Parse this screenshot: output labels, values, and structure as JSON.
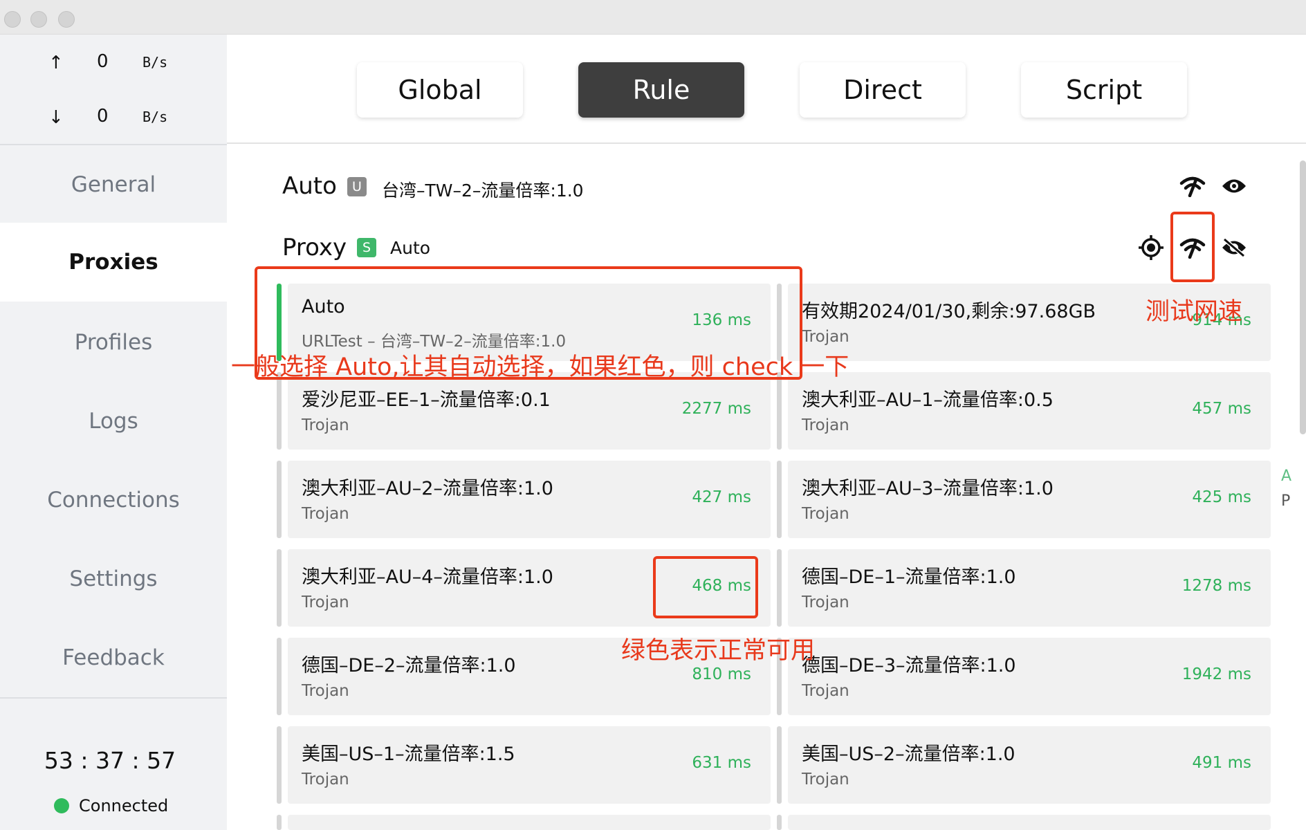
{
  "traffic": {
    "up": {
      "arrow": "↑",
      "value": "0",
      "unit": "B/s"
    },
    "down": {
      "arrow": "↓",
      "value": "0",
      "unit": "B/s"
    }
  },
  "nav": {
    "general": "General",
    "proxies": "Proxies",
    "profiles": "Profiles",
    "logs": "Logs",
    "connections": "Connections",
    "settings": "Settings",
    "feedback": "Feedback",
    "active": "Proxies"
  },
  "status": {
    "uptime": "53 : 37 : 57",
    "connection": "Connected"
  },
  "modes": {
    "global": "Global",
    "rule": "Rule",
    "direct": "Direct",
    "script": "Script",
    "active": "Rule"
  },
  "groups": {
    "auto": {
      "name": "Auto",
      "badge": "U",
      "current": "台湾–TW–2–流量倍率:1.0"
    },
    "proxy": {
      "name": "Proxy",
      "badge": "S",
      "current": "Auto"
    }
  },
  "proxies": [
    {
      "name": "Auto",
      "type": "URLTest – 台湾–TW–2–流量倍率:1.0",
      "delay": "136 ms",
      "selected": true
    },
    {
      "name": "有效期2024/01/30,剩余:97.68GB",
      "type": "Trojan",
      "delay": "914 ms"
    },
    {
      "name": "爱沙尼亚–EE–1–流量倍率:0.1",
      "type": "Trojan",
      "delay": "2277 ms"
    },
    {
      "name": "澳大利亚–AU–1–流量倍率:0.5",
      "type": "Trojan",
      "delay": "457 ms"
    },
    {
      "name": "澳大利亚–AU–2–流量倍率:1.0",
      "type": "Trojan",
      "delay": "427 ms"
    },
    {
      "name": "澳大利亚–AU–3–流量倍率:1.0",
      "type": "Trojan",
      "delay": "425 ms"
    },
    {
      "name": "澳大利亚–AU–4–流量倍率:1.0",
      "type": "Trojan",
      "delay": "468 ms"
    },
    {
      "name": "德国–DE–1–流量倍率:1.0",
      "type": "Trojan",
      "delay": "1278 ms"
    },
    {
      "name": "德国–DE–2–流量倍率:1.0",
      "type": "Trojan",
      "delay": "810 ms"
    },
    {
      "name": "德国–DE–3–流量倍率:1.0",
      "type": "Trojan",
      "delay": "1942 ms"
    },
    {
      "name": "美国–US–1–流量倍率:1.5",
      "type": "Trojan",
      "delay": "631 ms"
    },
    {
      "name": "美国–US–2–流量倍率:1.0",
      "type": "Trojan",
      "delay": "491 ms"
    }
  ],
  "index_letters": {
    "a": "A",
    "p": "P"
  },
  "annotations": {
    "speed_test": "测试网速",
    "auto_hint": "一般选择 Auto,让其自动选择，如果红色，则 check 一下",
    "green_hint": "绿色表示正常可用"
  },
  "icons": {
    "group_auto": [
      "speedtest-icon",
      "eye-icon"
    ],
    "group_proxy": [
      "locate-icon",
      "speedtest-icon",
      "eye-off-icon"
    ]
  },
  "colors": {
    "accent_green": "#2fbb5c",
    "delay_green": "#2fb15a",
    "active_mode_bg": "#3e3e3e",
    "annotation_red": "#ea3a1a",
    "badge_u": "#8a8a8a",
    "badge_s": "#3fb76a"
  }
}
